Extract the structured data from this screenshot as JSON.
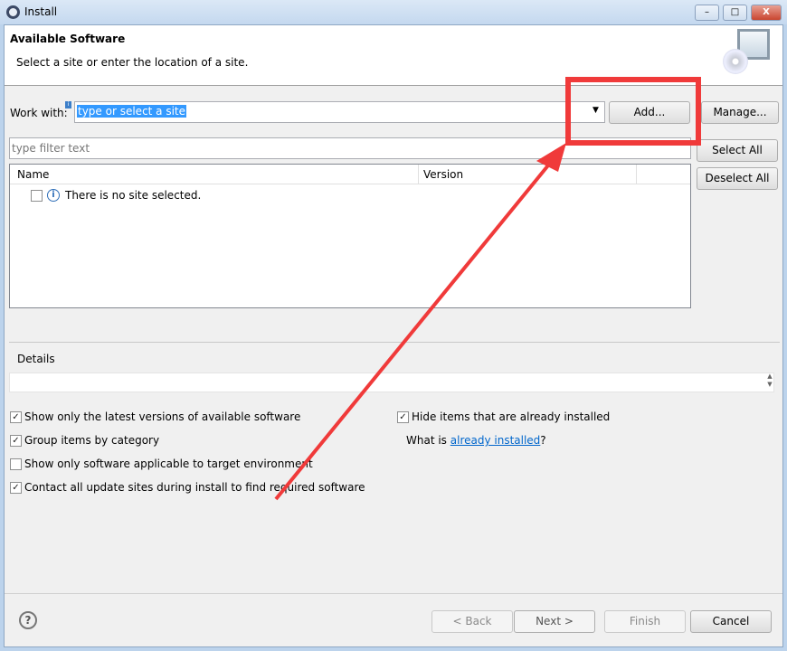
{
  "window": {
    "title": "Install"
  },
  "header": {
    "title": "Available Software",
    "subtitle": "Select a site or enter the location of a site."
  },
  "work_with": {
    "label": "Work with:",
    "value": "type or select a site",
    "add": "Add...",
    "manage": "Manage..."
  },
  "filter": {
    "placeholder": "type filter text"
  },
  "buttons": {
    "select_all": "Select All",
    "deselect_all": "Deselect All"
  },
  "table": {
    "columns": [
      "Name",
      "Version"
    ],
    "rows": [
      {
        "name": "There is no site selected.",
        "checked": false
      }
    ]
  },
  "details": {
    "label": "Details"
  },
  "options": {
    "latest": {
      "label": "Show only the latest versions of available software",
      "checked": true
    },
    "group": {
      "label": "Group items by category",
      "checked": true
    },
    "target": {
      "label": "Show only software applicable to target environment",
      "checked": false
    },
    "contact": {
      "label": "Contact all update sites during install to find required software",
      "checked": true
    },
    "hide": {
      "label": "Hide items that are already installed",
      "checked": true
    },
    "what_is": "What is ",
    "already_installed": "already installed",
    "q": "?"
  },
  "footer": {
    "back": "< Back",
    "next": "Next >",
    "finish": "Finish",
    "cancel": "Cancel"
  },
  "annotation": {
    "color": "#f03a3a"
  }
}
